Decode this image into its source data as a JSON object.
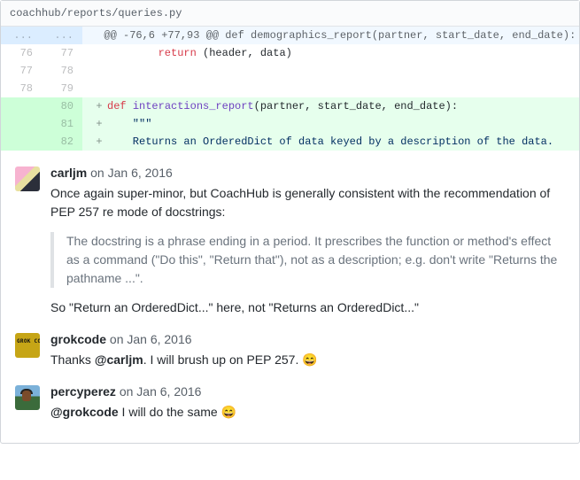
{
  "file": {
    "path": "coachhub/reports/queries.py"
  },
  "diff": {
    "hunk": {
      "old_ellipsis": "...",
      "new_ellipsis": "...",
      "header": "  @@ -76,6 +77,93 @@ def demographics_report(partner, start_date, end_date):"
    },
    "lines": {
      "l76_old": "76",
      "l76_new": "77",
      "l76_code_pre": "        ",
      "l76_kw1": "return",
      "l76_rest": " (header, data)",
      "l77_old": "77",
      "l77_new": "78",
      "l77_code": " ",
      "l78_old": "78",
      "l78_new": "79",
      "l78_code": " ",
      "l80_new": "80",
      "l80_sign": "+",
      "l80_kw1": "def",
      "l80_sp": " ",
      "l80_fn": "interactions_report",
      "l80_rest": "(partner, start_date, end_date):",
      "l81_new": "81",
      "l81_sign": "+",
      "l81_code": "    \"\"\"",
      "l82_new": "82",
      "l82_sign": "+",
      "l82_code": "    Returns an OrderedDict of data keyed by a description of the data."
    }
  },
  "comments": [
    {
      "author": "carljm",
      "time": "on Jan 6, 2016",
      "avatar": "av-1",
      "paragraphs": [
        "Once again super-minor, but CoachHub is generally consistent with the recommendation of PEP 257 re mode of docstrings:"
      ],
      "quote": "The docstring is a phrase ending in a period. It prescribes the function or method's effect as a command (\"Do this\", \"Return that\"), not as a description; e.g. don't write \"Returns the pathname ...\".",
      "paragraphs2": [
        "So \"Return an OrderedDict...\" here, not \"Returns an OrderedDict...\""
      ]
    },
    {
      "author": "grokcode",
      "time": "on Jan 6, 2016",
      "avatar": "av-2",
      "text_before": "Thanks ",
      "mention": "@carljm",
      "text_after": ". I will brush up on PEP 257. 😄"
    },
    {
      "author": "percyperez",
      "time": "on Jan 6, 2016",
      "avatar": "av-3",
      "text_before": "",
      "mention": "@grokcode",
      "text_after": " I will do the same 😄"
    }
  ]
}
